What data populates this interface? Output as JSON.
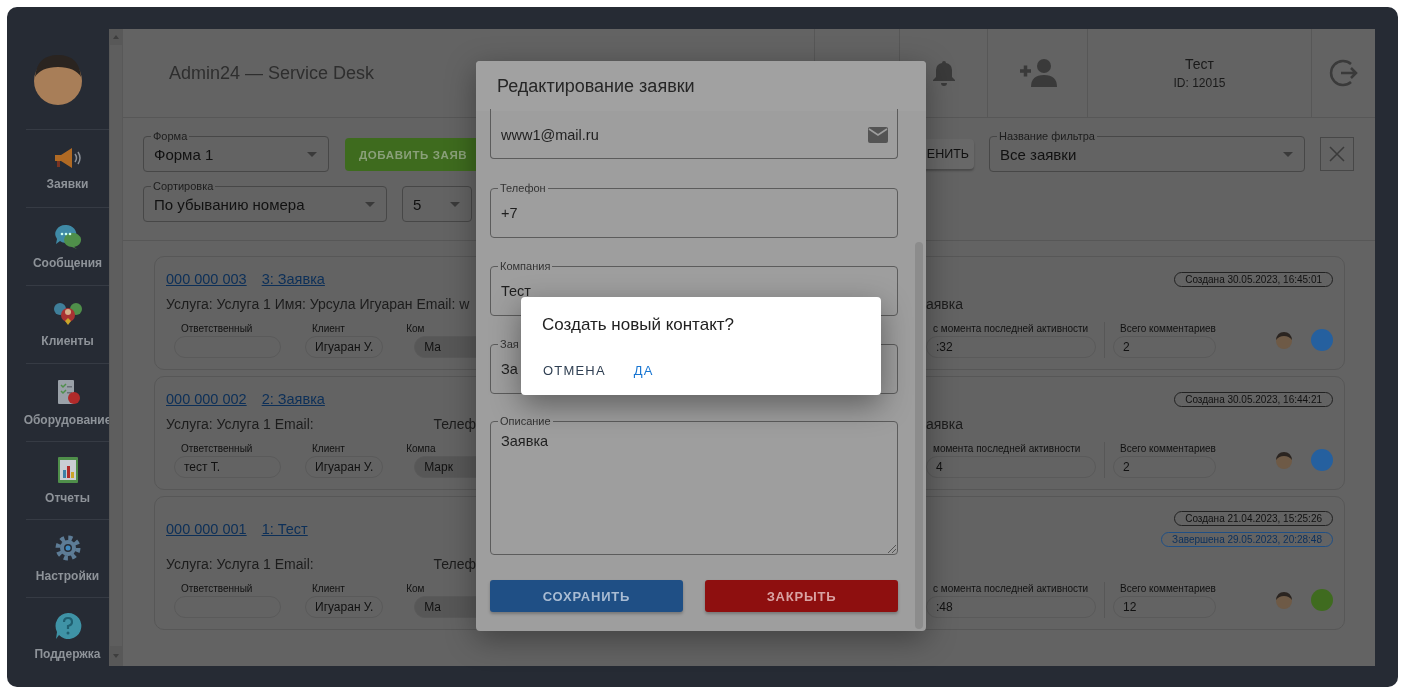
{
  "sidebar": {
    "items": [
      {
        "label": "Заявки"
      },
      {
        "label": "Сообщения"
      },
      {
        "label": "Клиенты"
      },
      {
        "label": "Оборудование"
      },
      {
        "label": "Отчеты"
      },
      {
        "label": "Настройки"
      },
      {
        "label": "Поддержка"
      }
    ]
  },
  "header": {
    "title": "Admin24 — Service Desk",
    "user": {
      "name": "Тест",
      "id": "ID: 12015"
    }
  },
  "filters": {
    "form": {
      "label": "Форма",
      "value": "Форма 1"
    },
    "add_button": "ДОБАВИТЬ ЗАЯВ",
    "apply_button": "ЕНИТЬ",
    "filter_name": {
      "label": "Название фильтра",
      "value": "Все заявки"
    },
    "sort": {
      "label": "Сортировка",
      "value": "По убыванию номера"
    },
    "page_size": {
      "value": "5"
    }
  },
  "tickets": [
    {
      "number": "000 000 003",
      "title": "3: Заявка",
      "summary": [
        "Услуга: Услуга 1 Имя: Урсула Игуаран Email: w"
      ],
      "tail": "аявка",
      "dates": [
        {
          "kind": "created",
          "text": "Создана 30.05.2023, 16:45:01"
        }
      ],
      "responsible": {
        "label": "Ответственный"
      },
      "client": {
        "label": "Клиент",
        "value": "Игуаран У."
      },
      "company": {
        "label": "Ком",
        "value": "Ма"
      },
      "activity": {
        "label": "с момента последней активности",
        "value": ":32"
      },
      "comments": {
        "label": "Всего комментариев",
        "value": "2"
      },
      "color": "#25609f"
    },
    {
      "number": "000 000 002",
      "title": "2: Заявка",
      "summary": [
        "Услуга: Услуга 1 Email:",
        "Телеф"
      ],
      "tail": "аявка",
      "dates": [
        {
          "kind": "created",
          "text": "Создана 30.05.2023, 16:44:21"
        }
      ],
      "responsible": {
        "label": "Ответственный",
        "value": "тест Т."
      },
      "client": {
        "label": "Клиент",
        "value": "Игуаран У."
      },
      "company": {
        "label": "Компа",
        "value": "Марк"
      },
      "activity": {
        "label": "момента последней активности",
        "value": "4"
      },
      "comments": {
        "label": "Всего комментариев",
        "value": "2"
      },
      "color": "#25609f"
    },
    {
      "number": "000 000 001",
      "title": "1: Тест",
      "summary": [
        "Услуга: Услуга 1 Email:",
        "Телеф"
      ],
      "dates": [
        {
          "kind": "created",
          "text": "Создана 21.04.2023, 15:25:26"
        },
        {
          "kind": "completed",
          "text": "Завершена 29.05.2023, 20:28:48"
        }
      ],
      "responsible": {
        "label": "Ответственный"
      },
      "client": {
        "label": "Клиент",
        "value": "Игуаран У."
      },
      "company": {
        "label": "Ком",
        "value": "Ма"
      },
      "activity": {
        "label": "с момента последней активности",
        "value": ":48"
      },
      "comments": {
        "label": "Всего комментариев",
        "value": "12"
      },
      "color": "#3f6b1f"
    }
  ],
  "modal": {
    "title": "Редактирование заявки",
    "fields": [
      {
        "kind": "email",
        "value": "www1@mail.ru"
      },
      {
        "kind": "text",
        "label": "Телефон",
        "value": "+7"
      },
      {
        "kind": "text",
        "label": "Компания",
        "value": "Тест"
      },
      {
        "kind": "text",
        "label": "Зая",
        "value": "За"
      },
      {
        "kind": "textarea",
        "label": "Описание",
        "value": "Заявка"
      }
    ],
    "buttons": [
      {
        "kind": "primary",
        "label": "СОХРАНИТЬ"
      },
      {
        "kind": "danger",
        "label": "ЗАКРЫТЬ"
      }
    ]
  },
  "confirm": {
    "title": "Создать новый контакт?",
    "buttons": [
      {
        "kind": "neutral",
        "label": "ОТМЕНА"
      },
      {
        "kind": "accent",
        "label": "ДА"
      }
    ]
  }
}
